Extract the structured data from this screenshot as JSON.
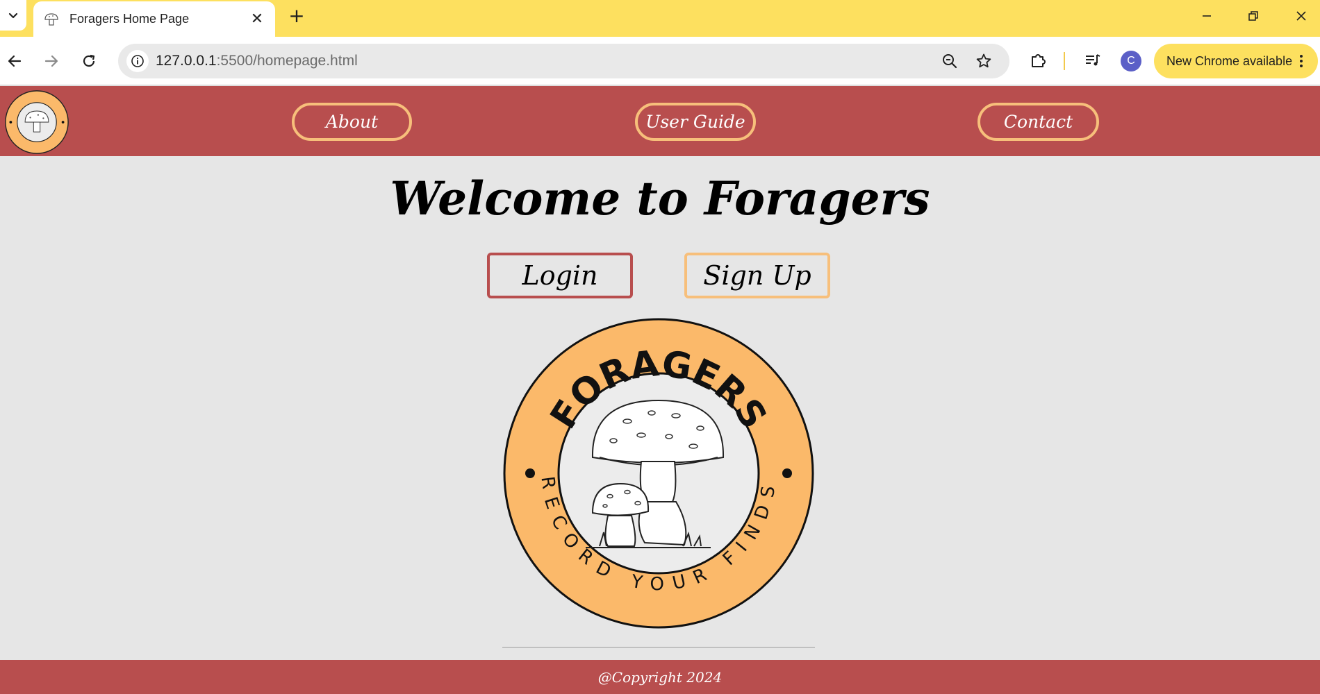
{
  "browser": {
    "tab": {
      "title": "Foragers Home Page"
    },
    "address": {
      "host": "127.0.0.1",
      "path": ":5500/homepage.html"
    },
    "avatar_initial": "C",
    "update_label": "New Chrome available"
  },
  "header": {
    "nav": [
      "About",
      "User Guide",
      "Contact"
    ]
  },
  "main": {
    "welcome": "Welcome to Foragers",
    "login_label": "Login",
    "signup_label": "Sign Up"
  },
  "logo": {
    "top_text": "FORAGERS",
    "bottom_text": "RECORD YOUR FINDS"
  },
  "footer": {
    "copyright": "@Copyright 2024"
  },
  "colors": {
    "header_bg": "#b84e4e",
    "accent_orange": "#f7bf7b",
    "chrome_yellow": "#fde05f",
    "logo_fill": "#fbb96a"
  }
}
